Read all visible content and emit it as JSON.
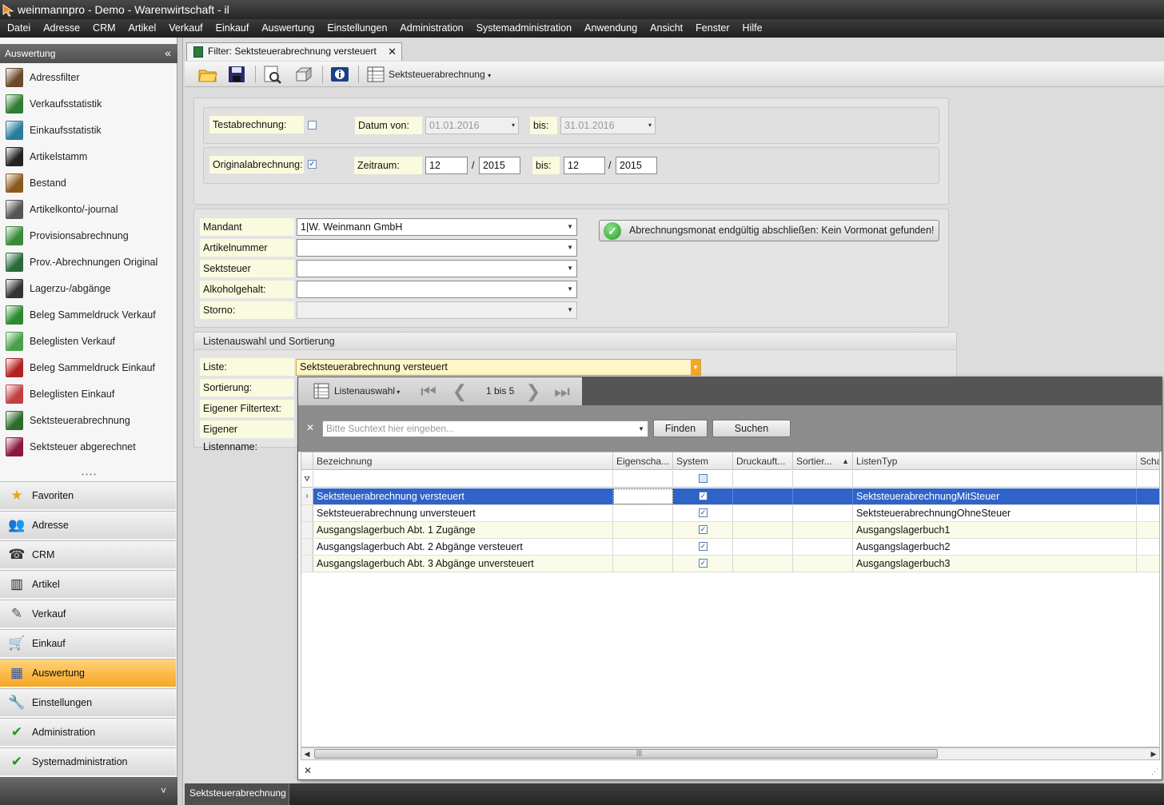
{
  "window": {
    "title": "weinmannpro - Demo - Warenwirtschaft - il"
  },
  "menu": [
    "Datei",
    "Adresse",
    "CRM",
    "Artikel",
    "Verkauf",
    "Einkauf",
    "Auswertung",
    "Einstellungen",
    "Administration",
    "Systemadministration",
    "Anwendung",
    "Ansicht",
    "Fenster",
    "Hilfe"
  ],
  "sidebar": {
    "header": "Auswertung",
    "collapse_icon": "«",
    "items": [
      {
        "label": "Adressfilter",
        "icon": "person-icon"
      },
      {
        "label": "Verkaufsstatistik",
        "icon": "bar-chart-icon"
      },
      {
        "label": "Einkaufsstatistik",
        "icon": "pie-chart-icon"
      },
      {
        "label": "Artikelstamm",
        "icon": "barcode-icon"
      },
      {
        "label": "Bestand",
        "icon": "warehouse-icon"
      },
      {
        "label": "Artikelkonto/-journal",
        "icon": "journal-icon"
      },
      {
        "label": "Provisionsabrechnung",
        "icon": "commission-icon"
      },
      {
        "label": "Prov.-Abrechnungen Original",
        "icon": "commission-original-icon"
      },
      {
        "label": "Lagerzu-/abgänge",
        "icon": "forklift-icon"
      },
      {
        "label": "Beleg Sammeldruck Verkauf",
        "icon": "green-book-icon"
      },
      {
        "label": "Beleglisten Verkauf",
        "icon": "green-list-icon"
      },
      {
        "label": "Beleg Sammeldruck Einkauf",
        "icon": "red-book-icon"
      },
      {
        "label": "Beleglisten Einkauf",
        "icon": "red-list-icon"
      },
      {
        "label": "Sektsteuerabrechnung",
        "icon": "tax-green-icon"
      },
      {
        "label": "Sektsteuer abgerechnet",
        "icon": "tax-red-icon"
      }
    ],
    "categories": [
      {
        "label": "Favoriten",
        "icon": "star-icon"
      },
      {
        "label": "Adresse",
        "icon": "contacts-icon"
      },
      {
        "label": "CRM",
        "icon": "phone-icon"
      },
      {
        "label": "Artikel",
        "icon": "barcode-icon"
      },
      {
        "label": "Verkauf",
        "icon": "document-icon"
      },
      {
        "label": "Einkauf",
        "icon": "cart-icon"
      },
      {
        "label": "Auswertung",
        "icon": "grid-icon",
        "active": true
      },
      {
        "label": "Einstellungen",
        "icon": "wrench-icon"
      },
      {
        "label": "Administration",
        "icon": "check-icon"
      },
      {
        "label": "Systemadministration",
        "icon": "check-icon"
      }
    ],
    "footer_icon": "˅"
  },
  "tab": {
    "label": "Filter: Sektsteuerabrechnung versteuert",
    "close": "✕"
  },
  "toolbar": {
    "dropdown_label": "Sektsteuerabrechnung"
  },
  "filter": {
    "test_label": "Testabrechnung:",
    "test_checked": false,
    "datum_von_label": "Datum von:",
    "datum_von": "01.01.2016",
    "bis_label": "bis:",
    "datum_bis": "31.01.2016",
    "original_label": "Originalabrechnung:",
    "original_checked": true,
    "zeitraum_label": "Zeitraum:",
    "zeitraum_von_monat": "12",
    "zeitraum_von_jahr": "2015",
    "zeitraum_bis_monat": "12",
    "zeitraum_bis_jahr": "2015",
    "slash": "/"
  },
  "params": {
    "mandant_label": "Mandant",
    "mandant": "1|W. Weinmann GmbH",
    "artikel_label": "Artikelnummer",
    "sekt_label": "Sektsteuer",
    "alkohol_label": "Alkoholgehalt:",
    "storno_label": "Storno:",
    "close_month_button": "Abrechnungsmonat endgültig abschließen: Kein Vormonat gefunden!"
  },
  "list": {
    "section_title": "Listenauswahl und Sortierung",
    "liste_label": "Liste:",
    "liste_value": "Sektsteuerabrechnung versteuert",
    "sortierung_label": "Sortierung:",
    "filtertext_label": "Eigener Filtertext:",
    "listenname_label": "Eigener Listenname:"
  },
  "popup": {
    "listenauswahl": "Listenauswahl",
    "page_info": "1 bis 5",
    "search_placeholder": "Bitte Suchtext hier eingeben...",
    "find_button": "Finden",
    "search_button": "Suchen",
    "columns": [
      "Bezeichnung",
      "Eigenscha...",
      "System",
      "Druckauft...",
      "Sortier...",
      "ListenTyp",
      "Scha"
    ],
    "sort_indicator": "▲",
    "rows": [
      {
        "bezeichnung": "Sektsteuerabrechnung versteuert",
        "system": true,
        "listentyp": "SektsteuerabrechnungMitSteuer",
        "selected": true
      },
      {
        "bezeichnung": "Sektsteuerabrechnung unversteuert",
        "system": true,
        "listentyp": "SektsteuerabrechnungOhneSteuer"
      },
      {
        "bezeichnung": "Ausgangslagerbuch Abt. 1 Zugänge",
        "system": true,
        "listentyp": "Ausgangslagerbuch1"
      },
      {
        "bezeichnung": "Ausgangslagerbuch Abt. 2 Abgänge versteuert",
        "system": true,
        "listentyp": "Ausgangslagerbuch2"
      },
      {
        "bezeichnung": "Ausgangslagerbuch Abt. 3 Abgänge unversteuert",
        "system": true,
        "listentyp": "Ausgangslagerbuch3"
      }
    ]
  },
  "statusbar": {
    "tab": "Sektsteuerabrechnung"
  }
}
